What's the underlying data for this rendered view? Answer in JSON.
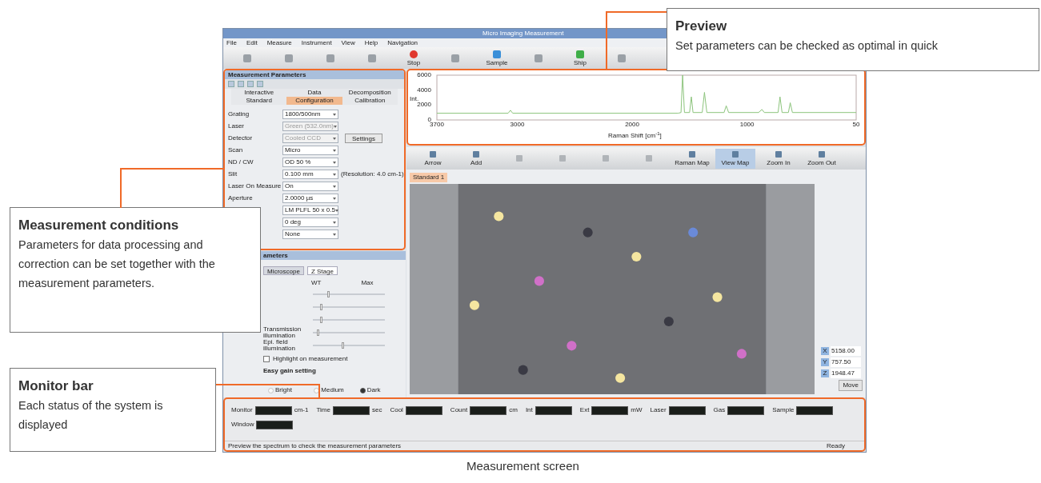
{
  "window": {
    "title": "Micro Imaging Measurement"
  },
  "menu": [
    "File",
    "Edit",
    "Measure",
    "Instrument",
    "View",
    "Help",
    "Navigation"
  ],
  "toolbar": [
    {
      "kind": "grey"
    },
    {
      "kind": "grey"
    },
    {
      "kind": "grey"
    },
    {
      "kind": "grey"
    },
    {
      "label": "Stop",
      "kind": "stop"
    },
    {
      "kind": "grey"
    },
    {
      "label": "Sample",
      "kind": "sample"
    },
    {
      "kind": "grey"
    },
    {
      "label": "Ship",
      "kind": "ship"
    },
    {
      "kind": "grey"
    }
  ],
  "params_panel": {
    "title": "Measurement Parameters",
    "tabs": [
      [
        {
          "label": "Interactive",
          "selected": false
        },
        {
          "label": "Data",
          "selected": false
        },
        {
          "label": "Decomposition",
          "selected": false
        }
      ],
      [
        {
          "label": "Standard",
          "selected": false
        },
        {
          "label": "Configuration",
          "selected": true
        },
        {
          "label": "Calibration",
          "selected": false
        }
      ]
    ],
    "rows": [
      {
        "label": "Grating",
        "value": "1800/500nm",
        "disabled": false
      },
      {
        "label": "Laser",
        "value": "Green (532.0nm)",
        "disabled": true
      },
      {
        "label": "Detector",
        "value": "Cooled CCD",
        "disabled": true,
        "button": "Settings"
      },
      {
        "label": "Scan",
        "value": "Micro",
        "disabled": false
      },
      {
        "label": "ND / CW",
        "value": "OD 50 %",
        "disabled": false
      },
      {
        "label": "Slit",
        "value": "0.100 mm",
        "disabled": false,
        "note": "(Resolution: 4.0 cm-1)"
      },
      {
        "label": "Laser On Measure",
        "value": "On",
        "disabled": false
      },
      {
        "label": "Aperture",
        "value": "2.0000 µs",
        "disabled": false
      },
      {
        "value": "LM PLFL 50 x 0.5",
        "disabled": false
      },
      {
        "value": "0 deg",
        "disabled": false
      },
      {
        "value": "None",
        "disabled": false
      }
    ]
  },
  "micro_panel": {
    "title": "ameters",
    "tabs": [
      {
        "label": "Microscope",
        "selected": false
      },
      {
        "label": "Z Stage",
        "selected": true
      }
    ],
    "columns": [
      "WT",
      "Max"
    ],
    "sliders": [
      {
        "level": 0.2
      },
      {
        "level": 0.1
      },
      {
        "level": 0.1
      },
      {
        "label": "Transmission illumination",
        "level": 0.05
      },
      {
        "label": "Epi. field illumination",
        "level": 0.4
      }
    ],
    "checkbox": {
      "label": "Highlight on measurement",
      "checked": false
    },
    "group": "Easy gain setting",
    "radios": [
      {
        "label": "Bright",
        "selected": false
      },
      {
        "label": "Medium",
        "selected": false
      },
      {
        "label": "Dark",
        "selected": true
      }
    ]
  },
  "preview": {
    "chart_data": {
      "type": "line",
      "xlabel": "Raman Shift [cm$^{-1}$]",
      "ylabel": "Int.",
      "x": [
        3700,
        3080,
        3060,
        3040,
        1600,
        1575,
        1561,
        1545,
        1500,
        1485,
        1470,
        1390,
        1371,
        1350,
        1200,
        1181,
        1160,
        900,
        870,
        850,
        730,
        713,
        695,
        640,
        624,
        605,
        50
      ],
      "series": [
        {
          "color": "#8cc47c",
          "values": [
            900,
            900,
            1300,
            900,
            900,
            1000,
            6000,
            1000,
            1000,
            3100,
            1000,
            1000,
            3700,
            1000,
            1000,
            1900,
            1000,
            1000,
            1400,
            1000,
            1000,
            3100,
            1000,
            1000,
            2300,
            1000,
            1000
          ]
        }
      ],
      "xlim": [
        3700,
        50
      ],
      "ylim": [
        0,
        6000
      ],
      "xticks": [
        3700,
        3000,
        2000,
        1000,
        50
      ],
      "yticks": [
        0,
        2000,
        4000,
        6000
      ]
    }
  },
  "image_toolbar": [
    {
      "label": "Arrow",
      "selected": false
    },
    {
      "label": "Add",
      "selected": false
    },
    {
      "selected": false
    },
    {
      "selected": false
    },
    {
      "selected": false
    },
    {
      "selected": false
    },
    {
      "label": "Raman Map",
      "selected": false
    },
    {
      "label": "View Map",
      "selected": true
    },
    {
      "label": "Zoom In",
      "selected": false
    },
    {
      "label": "Zoom Out",
      "selected": false
    }
  ],
  "image_tab": "Standard 1",
  "stage": [
    {
      "axis": "X",
      "value": "5158.00"
    },
    {
      "axis": "Y",
      "value": "757.50"
    },
    {
      "axis": "Z",
      "value": "1948.47"
    }
  ],
  "stage_button": "Move",
  "monitor": [
    {
      "label": "Monitor",
      "unit": "cm-1"
    },
    {
      "label": "Time",
      "unit": "sec"
    },
    {
      "label": "Cool"
    },
    {
      "label": "Count",
      "unit": "cm"
    },
    {
      "label": "Int"
    },
    {
      "label": "Ext",
      "unit": "mW"
    },
    {
      "label": "Laser"
    },
    {
      "label": "Gas"
    },
    {
      "label": "Sample"
    },
    {
      "label": "Window"
    }
  ],
  "status_bar": {
    "message": "Preview the spectrum to check the measurement parameters",
    "state": "Ready"
  },
  "callouts": [
    {
      "title": "Preview",
      "text": "Set parameters can be checked as optimal in quick"
    },
    {
      "title": "Measurement conditions",
      "text": "Parameters for data processing and correction can be set together with the measurement parameters."
    },
    {
      "title": "Monitor bar",
      "text": "Each status of the system is displayed"
    }
  ],
  "caption": "Measurement screen"
}
